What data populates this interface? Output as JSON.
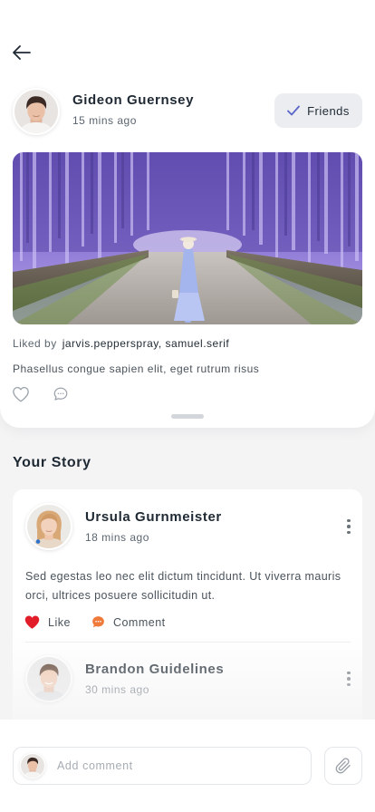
{
  "post": {
    "author_name": "Gideon Guernsey",
    "time": "15 mins ago",
    "friend_button_label": "Friends",
    "liked_by_label": "Liked by",
    "liked_by_users": "jarvis.pepperspray, samuel.serif",
    "caption": "Phasellus congue sapien elit, eget rutrum risus"
  },
  "story_section": {
    "title": "Your Story",
    "items": [
      {
        "name": "Ursula Gurnmeister",
        "time": "18 mins ago",
        "text": "Sed egestas leo nec elit dictum tincidunt. Ut viverra mauris orci, ultrices posuere sollicitudin ut.",
        "like_label": "Like",
        "comment_label": "Comment"
      },
      {
        "name": "Brandon Guidelines",
        "time": "30 mins ago"
      }
    ]
  },
  "comment_bar": {
    "placeholder": "Add comment"
  },
  "icons": {
    "back": "arrow-left-icon",
    "friends_check": "check-icon",
    "like": "heart-icon",
    "comment": "chat-bubble-icon",
    "more": "more-vertical-icon",
    "attach": "paperclip-icon"
  },
  "colors": {
    "like_active": "#e11d2a",
    "comment_active": "#f07a3a",
    "friends_check": "#5b67c9"
  }
}
